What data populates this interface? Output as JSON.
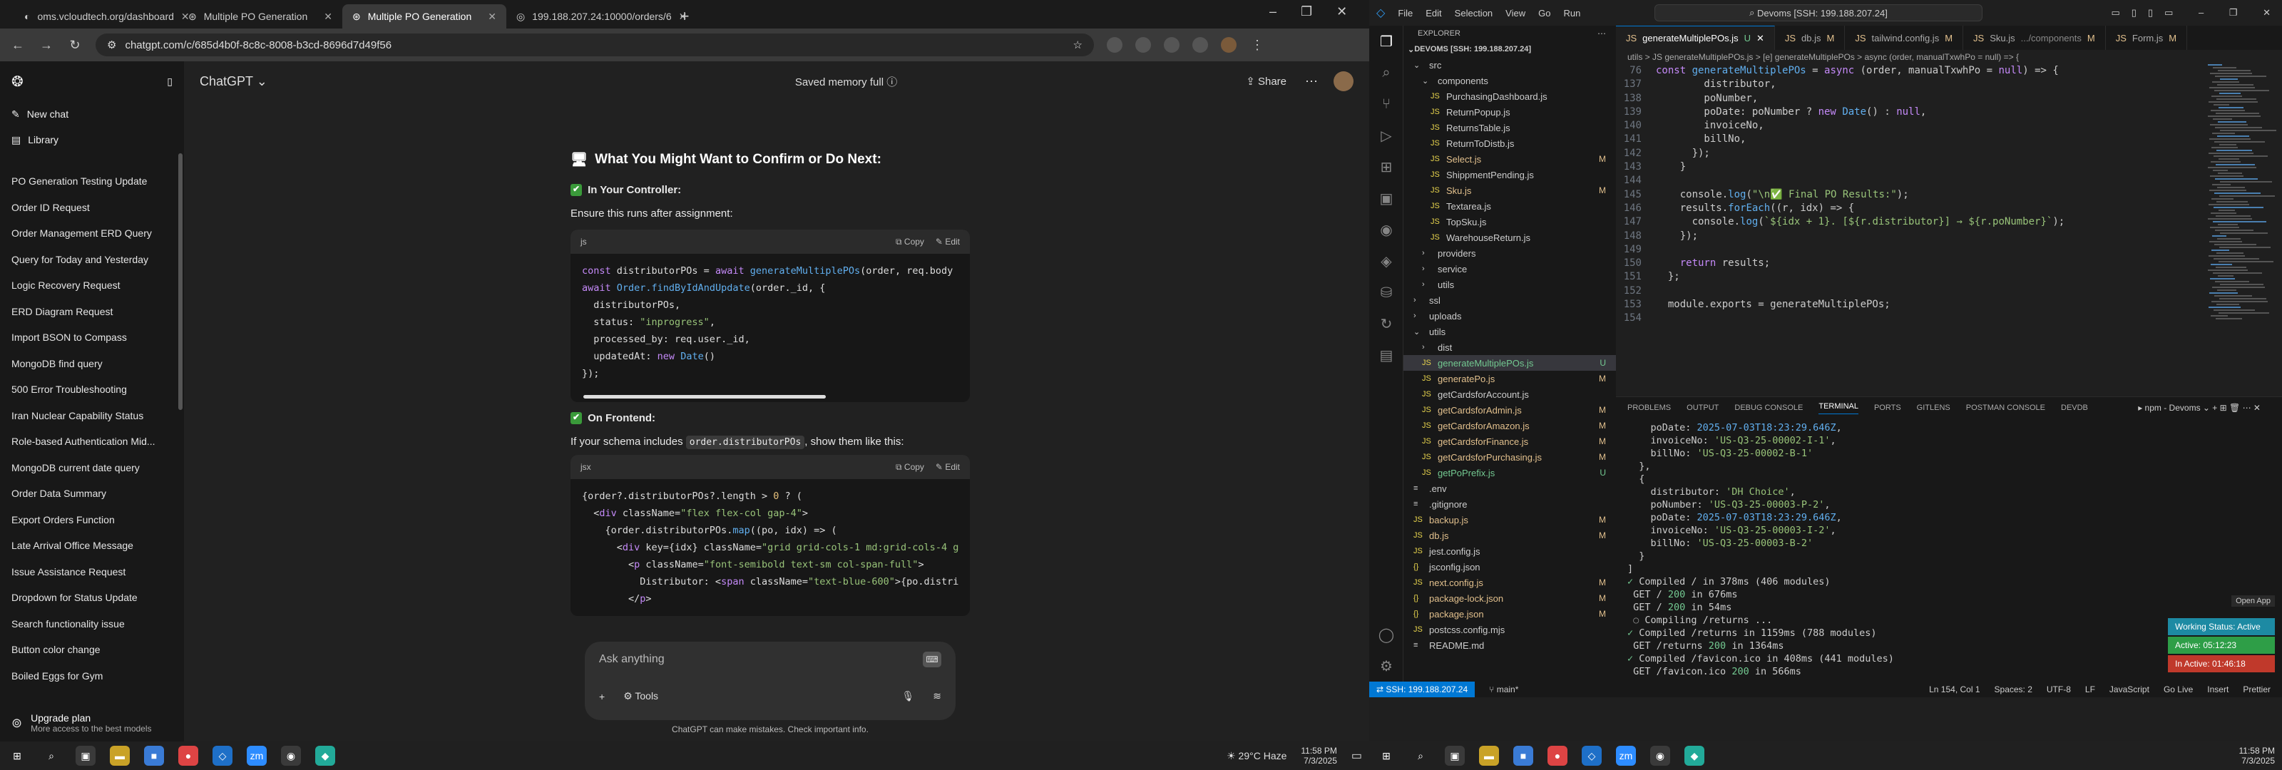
{
  "browser": {
    "tabs": [
      {
        "title": "oms.vcloudtech.org/dashboard"
      },
      {
        "title": "Multiple PO Generation"
      },
      {
        "title": "Multiple PO Generation"
      },
      {
        "title": "199.188.207.24:10000/orders/6"
      }
    ],
    "url": "chatgpt.com/c/685d4b0f-8c8c-8008-b3cd-8696d7d49f56"
  },
  "chatgpt": {
    "sidebar_actions": {
      "new_chat": "New chat",
      "library": "Library"
    },
    "history": [
      "PO Generation Testing Update",
      "Order ID Request",
      "Order Management ERD Query",
      "Query for Today and Yesterday",
      "Logic Recovery Request",
      "ERD Diagram Request",
      "Import BSON to Compass",
      "MongoDB find query",
      "500 Error Troubleshooting",
      "Iran Nuclear Capability Status",
      "Role-based Authentication Mid...",
      "MongoDB current date query",
      "Order Data Summary",
      "Export Orders Function",
      "Late Arrival Office Message",
      "Issue Assistance Request",
      "Dropdown for Status Update",
      "Search functionality issue",
      "Button color change",
      "Boiled Eggs for Gym"
    ],
    "upgrade": {
      "title": "Upgrade plan",
      "subtitle": "More access to the best models"
    },
    "model": "ChatGPT",
    "memory": "Saved memory full",
    "share": "Share",
    "heading": "What You Might Want to Confirm or Do Next:",
    "controller_title": "In Your Controller:",
    "controller_text": "Ensure this runs after assignment:",
    "code1_lang": "js",
    "code_copy": "Copy",
    "code_edit": "Edit",
    "frontend_title": "On Frontend:",
    "frontend_text_a": "If your schema includes",
    "frontend_code": "order.distributorPOs",
    "frontend_text_b": ", show them like this:",
    "code2_lang": "jsx",
    "composer_placeholder": "Ask anything",
    "tools": "Tools",
    "disclaimer": "ChatGPT can make mistakes. Check important info."
  },
  "taskbar_left": {
    "weather": "29°C  Haze",
    "time": "11:58 PM",
    "date": "7/3/2025"
  },
  "vscode": {
    "menu": [
      "File",
      "Edit",
      "Selection",
      "View",
      "Go",
      "Run"
    ],
    "command_center": "Devoms [SSH: 199.188.207.24]",
    "explorer_title": "EXPLORER",
    "root": "DEVOMS [SSH: 199.188.207.24]",
    "tabs": [
      "generateMultiplePOs.js",
      "db.js",
      "tailwind.config.js",
      "Sku.js",
      "Form.js"
    ],
    "breadcrumb": "utils > JS generateMultiplePOs.js > [e] generateMultiplePOs > async (order, manualTxwhPo = null) => {",
    "panel_tabs": [
      "PROBLEMS",
      "OUTPUT",
      "DEBUG CONSOLE",
      "TERMINAL",
      "PORTS",
      "GITLENS",
      "POSTMAN CONSOLE",
      "DEVDB"
    ],
    "terminal_label": "npm - Devoms",
    "badges": {
      "open_app": "Open App",
      "working": "Working Status: Active",
      "active": "Active: 05:12:23",
      "inactive": "In Active: 01:46:18"
    },
    "status": {
      "remote": "SSH: 199.188.207.24",
      "branch": "main*",
      "position": "Ln 154, Col 1",
      "spaces": "Spaces: 2",
      "encoding": "UTF-8",
      "eol": "LF",
      "language": "JavaScript",
      "golive": "Go Live",
      "insert": "Insert",
      "prettier": "Prettier"
    }
  },
  "taskbar_right": {
    "time": "11:58 PM",
    "date": "7/3/2025"
  }
}
